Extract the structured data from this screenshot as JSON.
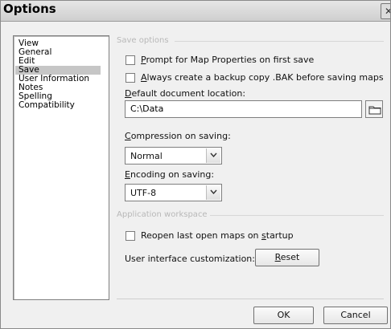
{
  "window": {
    "title": "Options",
    "close_icon": "close-icon"
  },
  "sidebar": {
    "items": [
      {
        "label": "View",
        "selected": false
      },
      {
        "label": "General",
        "selected": false
      },
      {
        "label": "Edit",
        "selected": false
      },
      {
        "label": "Save",
        "selected": true
      },
      {
        "label": "User Information",
        "selected": false
      },
      {
        "label": "Notes",
        "selected": false
      },
      {
        "label": "Spelling",
        "selected": false
      },
      {
        "label": "Compatibility",
        "selected": false
      }
    ]
  },
  "save_options": {
    "section_title": "Save options",
    "prompt_checkbox": {
      "label_pre": "",
      "label_ul": "P",
      "label_post": "rompt for Map Properties on first save",
      "checked": false
    },
    "backup_checkbox": {
      "label_pre": "",
      "label_ul": "A",
      "label_post": "lways create a backup copy .BAK before saving maps",
      "checked": false
    },
    "default_location": {
      "label_pre": "",
      "label_ul": "D",
      "label_post": "efault document location:",
      "value": "C:\\Data",
      "folder_icon": "folder-icon"
    },
    "compression": {
      "label_pre": "",
      "label_ul": "C",
      "label_post": "ompression on saving:",
      "selected": "Normal",
      "dropdown_icon": "chevron-down-icon"
    },
    "encoding": {
      "label_pre": "",
      "label_ul": "E",
      "label_post": "ncoding on saving:",
      "selected": "UTF-8",
      "dropdown_icon": "chevron-down-icon"
    }
  },
  "app_workspace": {
    "section_title": "Application workspace",
    "reopen_checkbox": {
      "label_pre": "Reopen last open maps on ",
      "label_ul": "s",
      "label_post": "tartup",
      "checked": false
    },
    "ui_customization": {
      "label": "User interface customization:",
      "reset": {
        "pre": "",
        "ul": "R",
        "post": "eset"
      }
    }
  },
  "buttons": {
    "ok": "OK",
    "cancel": "Cancel"
  },
  "colors": {
    "dialog_bg": "#f0f0f0",
    "selected_bg": "#c6c6c6",
    "section_text": "#b8b8b8"
  }
}
